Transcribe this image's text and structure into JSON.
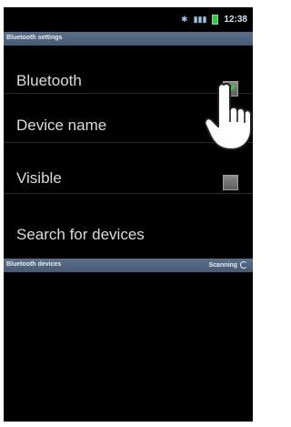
{
  "status_bar": {
    "time": "12:38",
    "icons": [
      "bluetooth-icon",
      "signal-icon",
      "battery-icon"
    ]
  },
  "bluetooth_settings_header": "Bluetooth settings",
  "settings": [
    {
      "label": "Bluetooth",
      "checked": true
    },
    {
      "label": "Device name"
    },
    {
      "label": "Visible",
      "checked": false
    },
    {
      "label": "Search for devices"
    }
  ],
  "devices_header": {
    "title": "Bluetooth devices",
    "status": "Scanning"
  },
  "colors": {
    "header_bg": "#4f637c",
    "background": "#000000",
    "battery": "#36c449"
  }
}
